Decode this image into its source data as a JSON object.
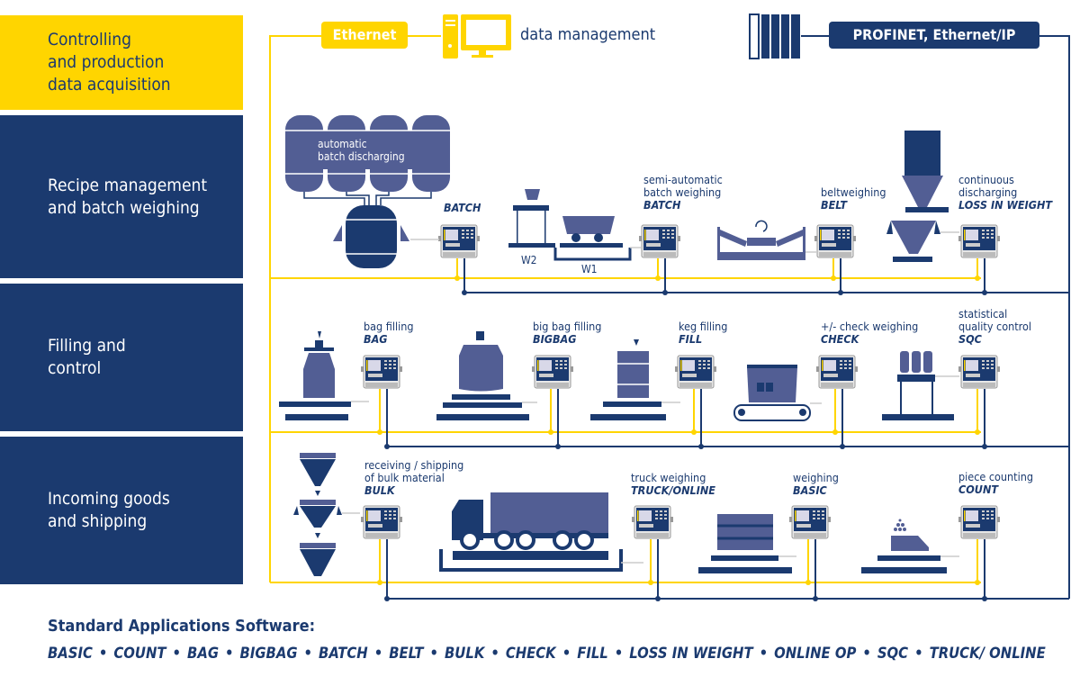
{
  "header": {
    "ethernet_label": "Ethernet",
    "data_management": "data management",
    "profinet_label": "PROFINET, Ethernet/IP",
    "computer_icon": "desktop-computer-icon",
    "plc_icon": "plc-rack-icon"
  },
  "sections": [
    {
      "lines": [
        "Controlling",
        "and production",
        "data acquisition"
      ],
      "color": "#ffd500"
    },
    {
      "lines": [
        "Recipe management",
        "and batch weighing"
      ],
      "color": "#1b3a6f"
    },
    {
      "lines": [
        "Filling and",
        "control"
      ],
      "color": "#1b3a6f"
    },
    {
      "lines": [
        "Incoming goods",
        "and shipping"
      ],
      "color": "#1b3a6f"
    }
  ],
  "recipe": {
    "tank_text": [
      "automatic",
      "batch discharging"
    ],
    "batch_auto": {
      "code": "BATCH"
    },
    "batch_semi": {
      "desc": [
        "semi-automatic",
        "batch weighing"
      ],
      "code": "BATCH"
    },
    "w2": "W2",
    "w1": "W1",
    "belt": {
      "desc": [
        "beltweighing"
      ],
      "code": "BELT"
    },
    "liw": {
      "desc": [
        "continuous",
        "discharging"
      ],
      "code": "LOSS IN WEIGHT"
    }
  },
  "filling": {
    "bag": {
      "desc": [
        "bag filling"
      ],
      "code": "BAG"
    },
    "bigbag": {
      "desc": [
        "big bag filling"
      ],
      "code": "BIGBAG"
    },
    "fill": {
      "desc": [
        "keg filling"
      ],
      "code": "FILL"
    },
    "check": {
      "desc": [
        "+/- check weighing"
      ],
      "code": "CHECK"
    },
    "sqc": {
      "desc": [
        "statistical",
        "quality control"
      ],
      "code": "SQC"
    }
  },
  "shipping": {
    "bulk": {
      "desc": [
        "receiving / shipping",
        "of bulk material"
      ],
      "code": "BULK"
    },
    "truck": {
      "desc": [
        "truck weighing"
      ],
      "code": "TRUCK/ONLINE"
    },
    "basic": {
      "desc": [
        "weighing"
      ],
      "code": "BASIC"
    },
    "count": {
      "desc": [
        "piece counting"
      ],
      "code": "COUNT"
    }
  },
  "footer": {
    "title": "Standard Applications Software:",
    "items": [
      "BASIC",
      "COUNT",
      "BAG",
      "BIGBAG",
      "BATCH",
      "BELT",
      "BULK",
      "CHECK",
      "FILL",
      "LOSS IN WEIGHT",
      "ONLINE OP",
      "SQC",
      "TRUCK/ ONLINE"
    ],
    "separator": "•"
  },
  "colors": {
    "yellow": "#ffd500",
    "navy": "#1b3a6f",
    "slate": "#525e94"
  }
}
